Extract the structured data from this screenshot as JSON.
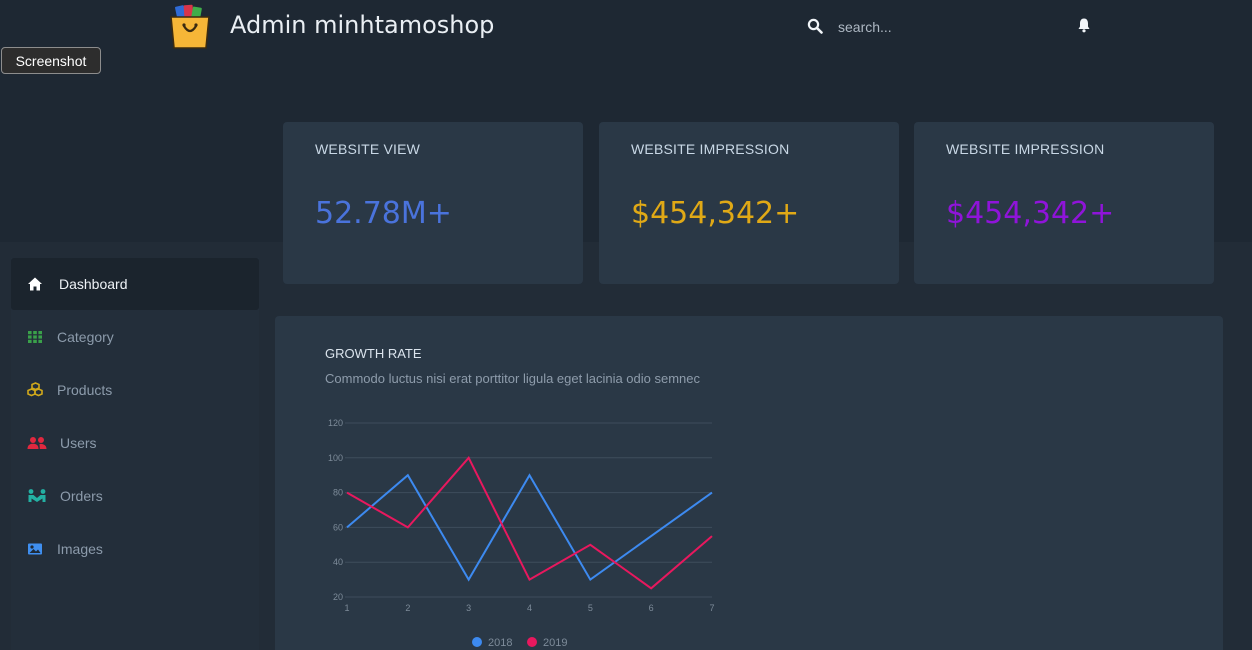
{
  "header": {
    "brand": "Admin minhtamoshop",
    "search_placeholder": "search...",
    "screenshot_label": "Screenshot",
    "icons": {
      "logo": "shopping-bag-logo",
      "search": "search-icon",
      "notifications": "bell-icon"
    }
  },
  "stats": [
    {
      "title": "WEBSITE VIEW",
      "value": "52.78M+",
      "color": "#4a73dc"
    },
    {
      "title": "WEBSITE IMPRESSION",
      "value": "$454,342+",
      "color": "#e0a916"
    },
    {
      "title": "WEBSITE IMPRESSION",
      "value": "$454,342+",
      "color": "#8f14d9"
    }
  ],
  "sidebar": {
    "items": [
      {
        "label": "Dashboard",
        "icon": "home-icon",
        "color": "#ffffff",
        "active": true
      },
      {
        "label": "Category",
        "icon": "grid-icon",
        "color": "#3aa14a",
        "active": false
      },
      {
        "label": "Products",
        "icon": "cubes-icon",
        "color": "#d1a91b",
        "active": false
      },
      {
        "label": "Users",
        "icon": "users-icon",
        "color": "#e0283f",
        "active": false
      },
      {
        "label": "Orders",
        "icon": "handshake-icon",
        "color": "#23b0a3",
        "active": false
      },
      {
        "label": "Images",
        "icon": "image-icon",
        "color": "#3f8ff0",
        "active": false
      }
    ]
  },
  "growth": {
    "title": "GROWTH RATE",
    "subtitle": "Commodo luctus nisi erat porttitor ligula eget lacinia odio semnec"
  },
  "chart_data": {
    "type": "line",
    "title": "GROWTH RATE",
    "x": [
      1,
      2,
      3,
      4,
      5,
      6,
      7
    ],
    "xlabel": "",
    "ylabel": "",
    "ylim": [
      20,
      120
    ],
    "yticks": [
      20,
      40,
      60,
      80,
      100,
      120
    ],
    "grid": true,
    "legend": "bottom",
    "series": [
      {
        "name": "2018",
        "color": "#3d8af0",
        "values": [
          60,
          90,
          30,
          90,
          30,
          55,
          80
        ]
      },
      {
        "name": "2019",
        "color": "#e8185e",
        "values": [
          80,
          60,
          100,
          30,
          50,
          25,
          55
        ]
      }
    ]
  }
}
